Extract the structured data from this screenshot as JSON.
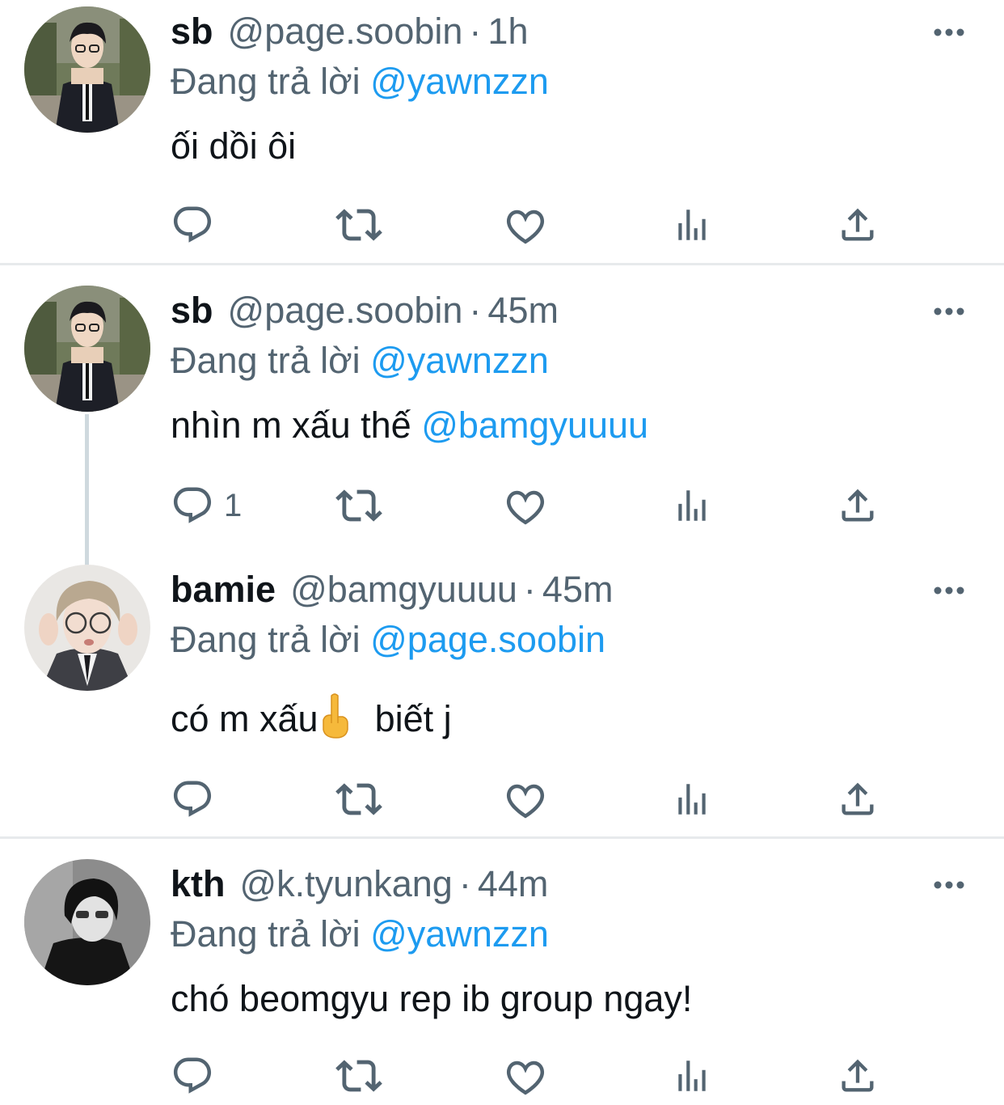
{
  "tweets": [
    {
      "display_name": "sb",
      "handle": "@page.soobin",
      "separator": "·",
      "time": "1h",
      "replying_prefix": "Đang trả lời",
      "replying_to": "@yawnzzn",
      "text": "ối dồi ôi",
      "reply_count": "",
      "avatar_icon": "avatar-sb"
    },
    {
      "display_name": "sb",
      "handle": "@page.soobin",
      "separator": "·",
      "time": "45m",
      "replying_prefix": "Đang trả lời",
      "replying_to": "@yawnzzn",
      "text": "nhìn m xấu thế",
      "text_mention": "@bamgyuuuu",
      "reply_count": "1",
      "avatar_icon": "avatar-sb"
    },
    {
      "display_name": "bamie",
      "handle": "@bamgyuuuu",
      "separator": "·",
      "time": "45m",
      "replying_prefix": "Đang trả lời",
      "replying_to": "@page.soobin",
      "text_before_emoji": "có m xấu",
      "emoji": "middle-finger-emoji",
      "text_after_emoji": "biết j",
      "reply_count": "",
      "avatar_icon": "avatar-bamie"
    },
    {
      "display_name": "kth",
      "handle": "@k.tyunkang",
      "separator": "·",
      "time": "44m",
      "replying_prefix": "Đang trả lời",
      "replying_to": "@yawnzzn",
      "text": "chó beomgyu rep ib group ngay!",
      "reply_count": "",
      "avatar_icon": "avatar-kth"
    }
  ],
  "action_icons": [
    "reply-icon",
    "retweet-icon",
    "like-icon",
    "views-icon",
    "share-icon"
  ],
  "more_icon": "more-options-icon",
  "colors": {
    "text": "#0f1419",
    "secondary": "#536471",
    "link": "#1d9bf0",
    "divider": "#e7eaec",
    "thread_line": "#cfd9de"
  }
}
